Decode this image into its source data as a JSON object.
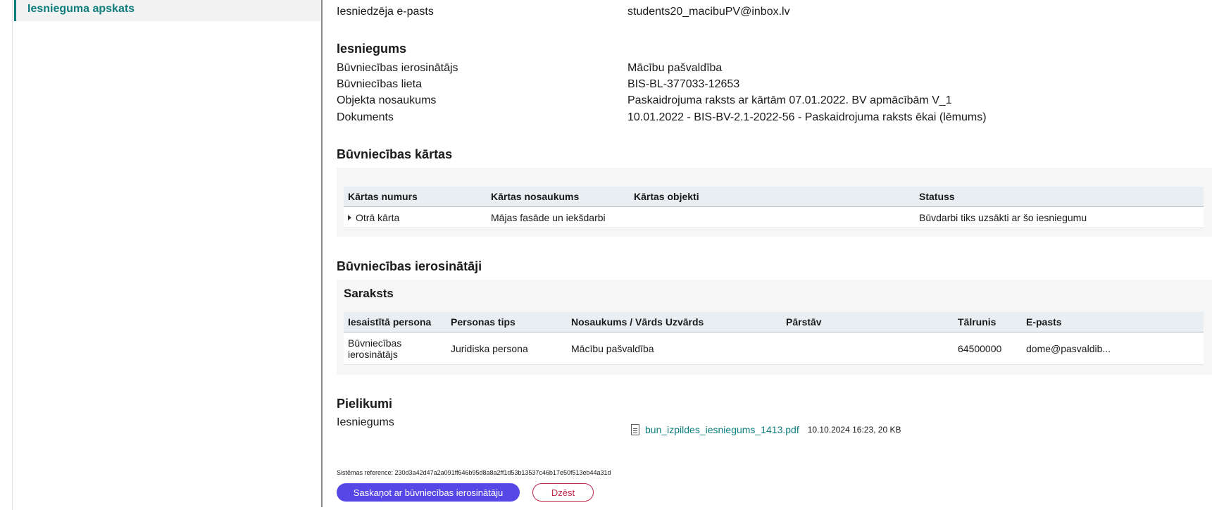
{
  "sidebar": {
    "active_item": "Iesnieguma apskats"
  },
  "header_rows": [
    {
      "label": "Iesniedzēja e-pasts",
      "value": "students20_macibuPV@inbox.lv"
    }
  ],
  "submission": {
    "title": "Iesniegums",
    "rows": [
      {
        "label": "Būvniecības ierosinātājs",
        "value": "Mācību pašvaldība"
      },
      {
        "label": "Būvniecības lieta",
        "value": "BIS-BL-377033-12653"
      },
      {
        "label": "Objekta nosaukums",
        "value": "Paskaidrojuma raksts ar kārtām 07.01.2022. BV apmācībām V_1"
      },
      {
        "label": "Dokuments",
        "value": "10.01.2022 - BIS-BV-2.1-2022-56 - Paskaidrojuma raksts ēkai (lēmums)"
      }
    ]
  },
  "stages": {
    "title": "Būvniecības kārtas",
    "columns": [
      "Kārtas numurs",
      "Kārtas nosaukums",
      "Kārtas objekti",
      "Statuss"
    ],
    "rows": [
      {
        "number": "Otrā kārta",
        "name": "Mājas fasāde un iekšdarbi",
        "objects": "",
        "status": "Būvdarbi tiks uzsākti ar šo iesniegumu"
      }
    ]
  },
  "initiators": {
    "title": "Būvniecības ierosinātāji",
    "list_title": "Saraksts",
    "columns": [
      "Iesaistītā persona",
      "Personas tips",
      "Nosaukums / Vārds Uzvārds",
      "Pārstāv",
      "Tālrunis",
      "E-pasts"
    ],
    "rows": [
      {
        "role": "Būvniecības ierosinātājs",
        "type": "Juridiska persona",
        "name": "Mācību pašvaldība",
        "represents": "",
        "phone": "64500000",
        "email": "dome@pasvaldib..."
      }
    ]
  },
  "attachments": {
    "title": "Pielikumi",
    "label": "Iesniegums",
    "file_name": "bun_izpildes_iesniegums_1413.pdf",
    "file_meta": "10.10.2024 16:23, 20 KB",
    "icon": "document-icon"
  },
  "system_reference": "Sistēmas reference: 230d3a42d47a2a091ff646b95d8a8a2ff1d53b13537c46b17e50f513eb44a31d",
  "actions": {
    "primary_label": "Saskaņot ar būvniecības ierosinātāju",
    "delete_label": "Dzēst"
  },
  "colors": {
    "accent": "#0d7d7e",
    "primary_button": "#5548e6",
    "danger": "#c0264a"
  }
}
